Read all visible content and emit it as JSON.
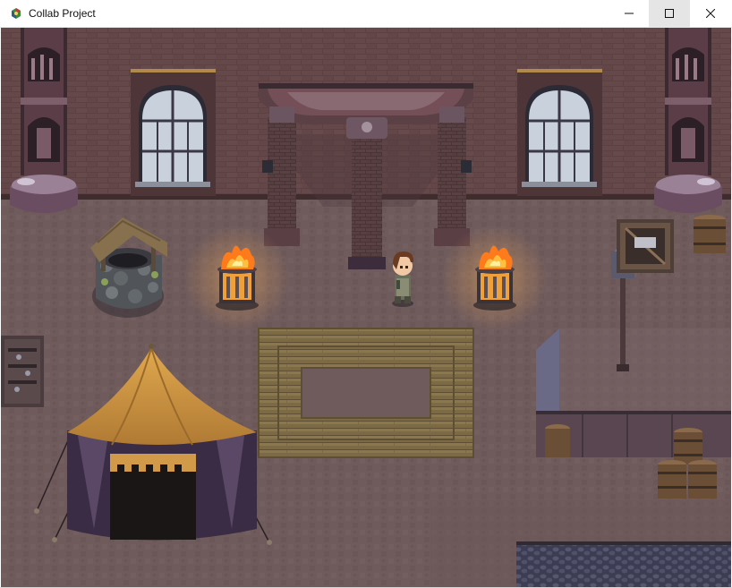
{
  "window": {
    "title": "Collab Project",
    "icons": {
      "app": "rpg-maker-app-icon",
      "minimize": "minimize-icon",
      "maximize": "maximize-icon",
      "close": "close-icon"
    }
  },
  "scene": {
    "type": "top-down pixel-art town square at night",
    "objects": [
      "brick-wall",
      "arched-window-left",
      "arched-window-right",
      "ornate-pillar-left",
      "ornate-pillar-right",
      "stone-gazebo",
      "stone-well",
      "fire-brazier-left",
      "fire-brazier-right",
      "player-character",
      "wooden-rug",
      "merchant-tent",
      "raised-platform",
      "street-lamp",
      "wooden-crate",
      "barrels",
      "wall-rack",
      "stone-ledge"
    ],
    "colors": {
      "floor": "#6e5a5b",
      "wall": "#5a3f40",
      "fire": "#ffb030",
      "tent": "#c8913e",
      "tent_dark": "#3a2c44",
      "rug": "#7c6a44"
    }
  }
}
